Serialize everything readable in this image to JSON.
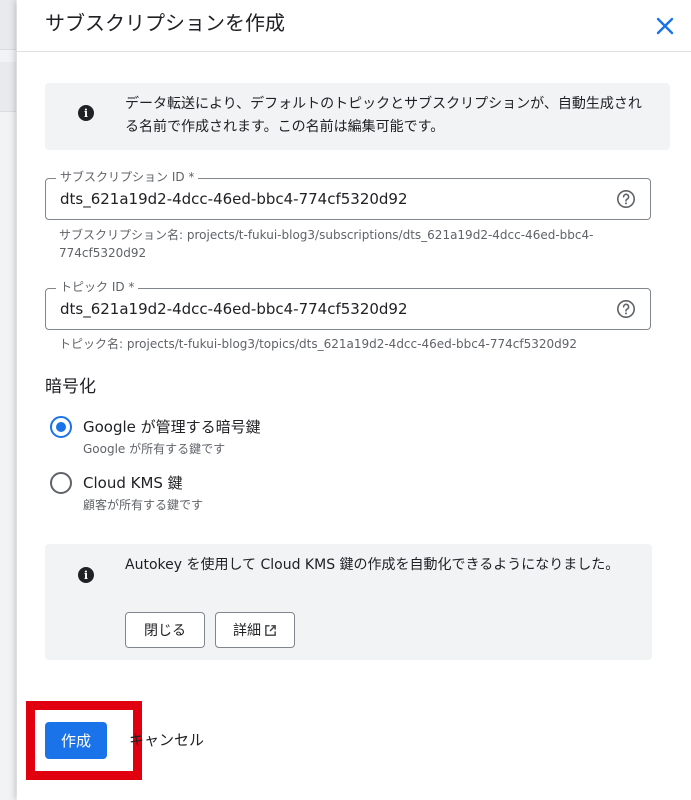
{
  "panel": {
    "title": "サブスクリプションを作成",
    "close_icon": "close-icon"
  },
  "info": {
    "icon": "info-icon",
    "text": "データ転送により、デフォルトのトピックとサブスクリプションが、自動生成される名前で作成されます。この名前は編集可能です。"
  },
  "subscription": {
    "label": "サブスクリプション ID *",
    "value": "dts_621a19d2-4dcc-46ed-bbc4-774cf5320d92",
    "hint": "サブスクリプション名: projects/t-fukui-blog3/subscriptions/dts_621a19d2-4dcc-46ed-bbc4-774cf5320d92",
    "help_icon": "help-icon"
  },
  "topic": {
    "label": "トピック ID *",
    "value": "dts_621a19d2-4dcc-46ed-bbc4-774cf5320d92",
    "hint": "トピック名: projects/t-fukui-blog3/topics/dts_621a19d2-4dcc-46ed-bbc4-774cf5320d92",
    "help_icon": "help-icon"
  },
  "encryption": {
    "title": "暗号化",
    "options": [
      {
        "label": "Google が管理する暗号鍵",
        "description": "Google が所有する鍵です",
        "selected": true
      },
      {
        "label": "Cloud KMS 鍵",
        "description": "顧客が所有する鍵です",
        "selected": false
      }
    ]
  },
  "autokey": {
    "icon": "info-icon",
    "text": "Autokey を使用して Cloud KMS 鍵の作成を自動化できるようになりました。",
    "close_label": "閉じる",
    "detail_label": "詳細",
    "external_icon": "open-in-new-icon"
  },
  "footer": {
    "create_label": "作成",
    "cancel_label": "キャンセル"
  },
  "colors": {
    "accent": "#1a73e8",
    "highlight": "#e0000f",
    "info_bg": "#f1f3f4"
  }
}
